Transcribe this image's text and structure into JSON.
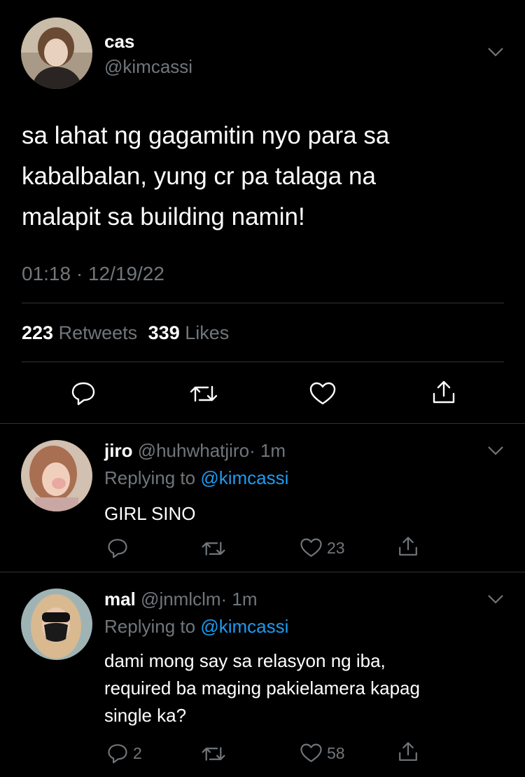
{
  "main_tweet": {
    "display_name": "cas",
    "handle": "@kimcassi",
    "text_lines": [
      "sa lahat ng gagamitin nyo para sa",
      "kabalbalan, yung cr pa talaga na",
      "malapit sa building namin!"
    ],
    "timestamp": "01:18 · 12/19/22",
    "retweet_count": "223",
    "retweet_label": "Retweets",
    "like_count": "339",
    "like_label": "Likes"
  },
  "replies": [
    {
      "display_name": "jiro",
      "handle": "@huhwhatjiro",
      "time": "· 1m",
      "replying_prefix": "Replying to",
      "replying_handle": "@kimcassi",
      "text_lines": [
        "GIRL SINO"
      ],
      "reply_count": "",
      "like_count": "23"
    },
    {
      "display_name": "mal",
      "handle": "@jnmlclm",
      "time": "· 1m",
      "replying_prefix": "Replying to",
      "replying_handle": "@kimcassi",
      "text_lines": [
        "dami mong say sa relasyon ng iba,",
        "required ba maging pakielamera kapag",
        "single ka?"
      ],
      "reply_count": "2",
      "like_count": "58"
    }
  ],
  "colors": {
    "background": "#000000",
    "text": "#ffffff",
    "muted": "#71767b",
    "link": "#1d9bf0",
    "divider": "#2f3336"
  },
  "icons": [
    "chevron-down-icon",
    "reply-icon",
    "retweet-icon",
    "like-icon",
    "share-icon"
  ]
}
